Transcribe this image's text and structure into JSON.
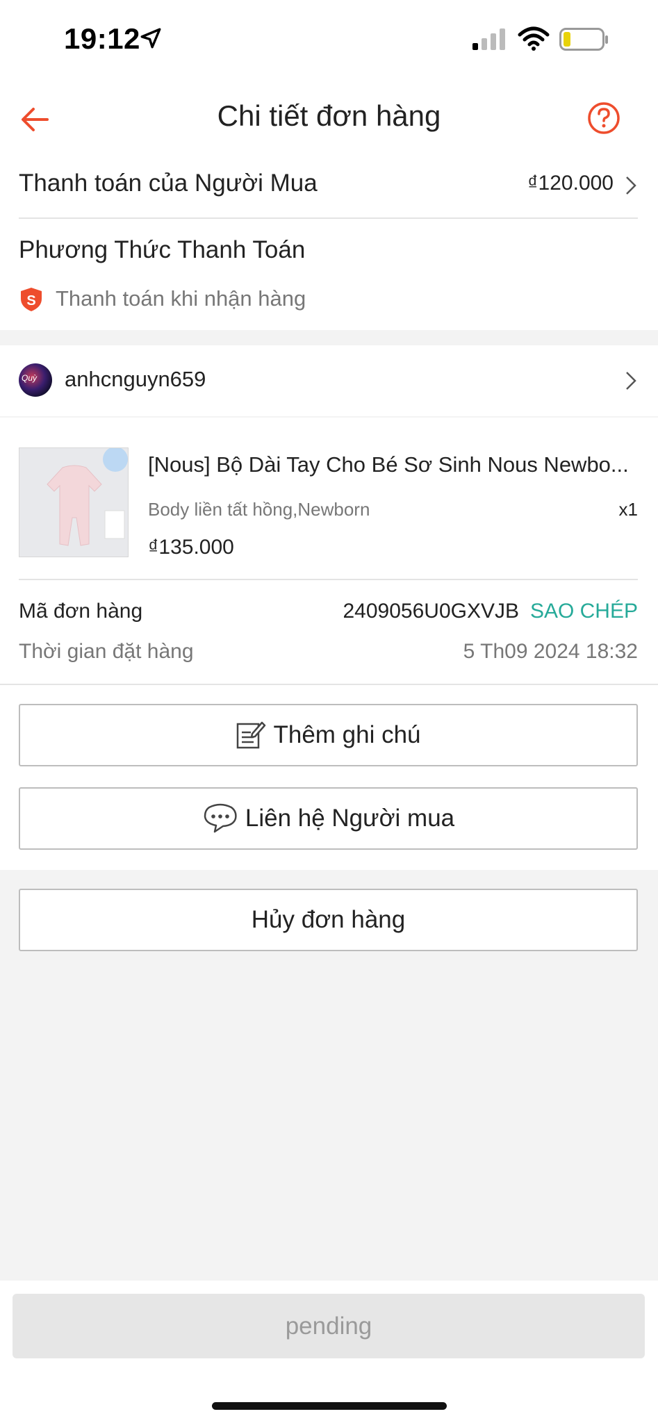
{
  "status_bar": {
    "time": "19:12"
  },
  "header": {
    "title": "Chi tiết đơn hàng",
    "back_icon": "arrow-left-icon",
    "help_icon": "question-circle-icon",
    "accent": "#ee4d2d"
  },
  "payment": {
    "buyer_payment_label": "Thanh toán của Người Mua",
    "buyer_payment_amount": "₫120.000",
    "method_title": "Phương Thức Thanh Toán",
    "method_value": "Thanh toán khi nhận hàng"
  },
  "buyer": {
    "username": "anhcnguyn659"
  },
  "product": {
    "name": "[Nous] Bộ Dài Tay Cho Bé Sơ Sinh Nous Newbo...",
    "variant": "Body liền tất hồng,Newborn",
    "quantity": "x1",
    "price": "₫135.000"
  },
  "order": {
    "code_label": "Mã đơn hàng",
    "code_value": "2409056U0GXVJB",
    "copy_label": "SAO CHÉP",
    "time_label": "Thời gian đặt hàng",
    "time_value": "5 Th09 2024 18:32",
    "copy_color": "#26aa99"
  },
  "actions": {
    "add_note": "Thêm ghi chú",
    "contact_buyer": "Liên hệ Người mua",
    "cancel_order": "Hủy đơn hàng"
  },
  "footer": {
    "pending": "pending"
  }
}
